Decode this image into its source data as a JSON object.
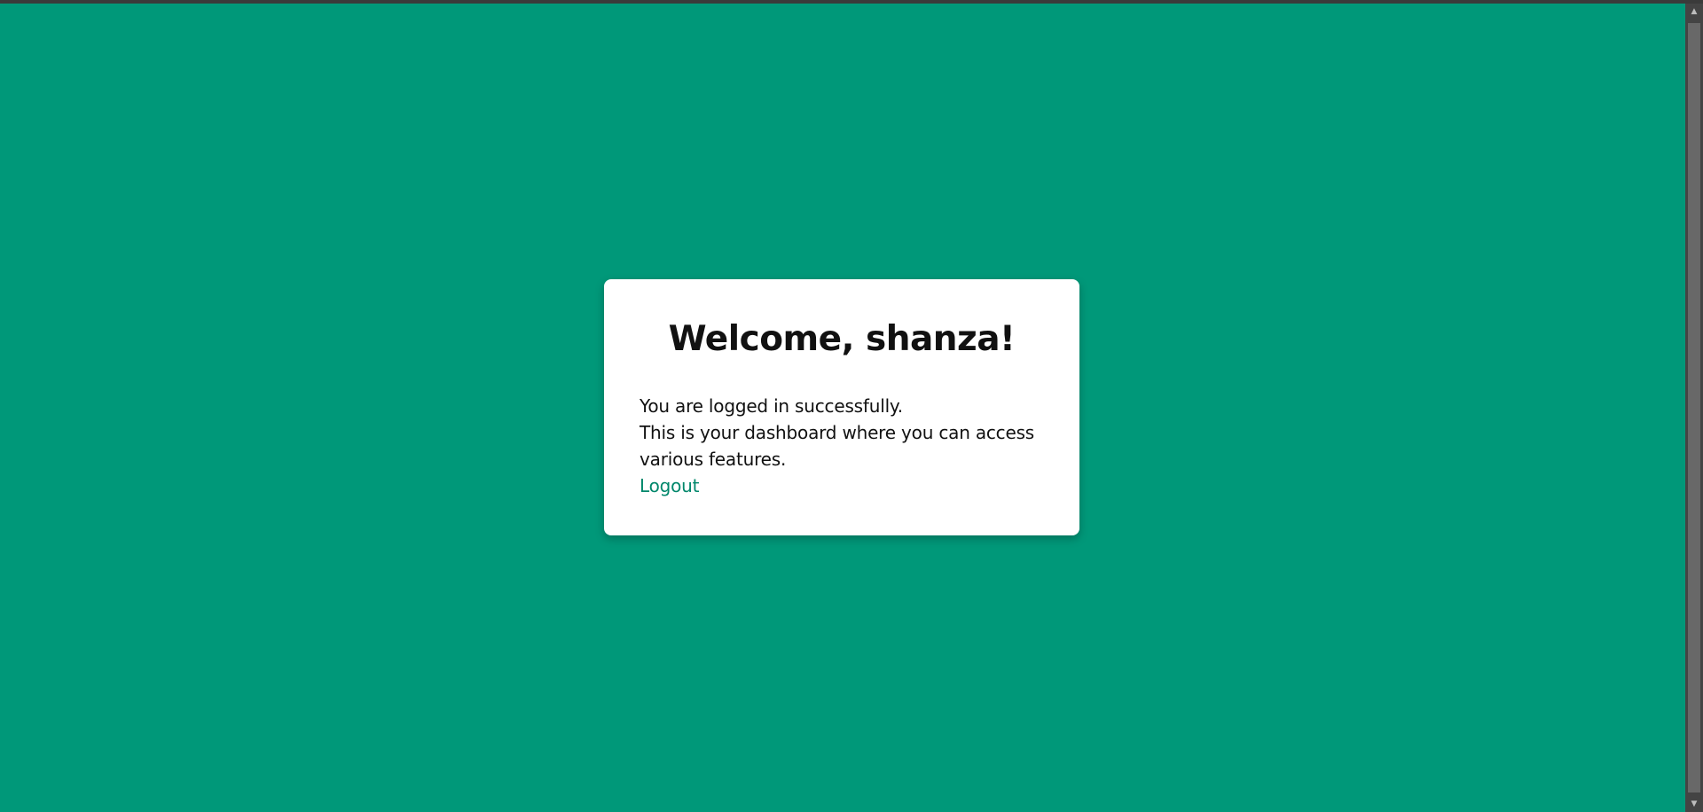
{
  "colors": {
    "page_background": "#009879",
    "card_background": "#ffffff",
    "link": "#00876b"
  },
  "card": {
    "title": "Welcome, shanza!",
    "line1": "You are logged in successfully.",
    "line2": "This is your dashboard where you can access various features.",
    "logout_label": "Logout"
  },
  "scrollbar": {
    "up_icon": "▲",
    "down_icon": "▼"
  }
}
